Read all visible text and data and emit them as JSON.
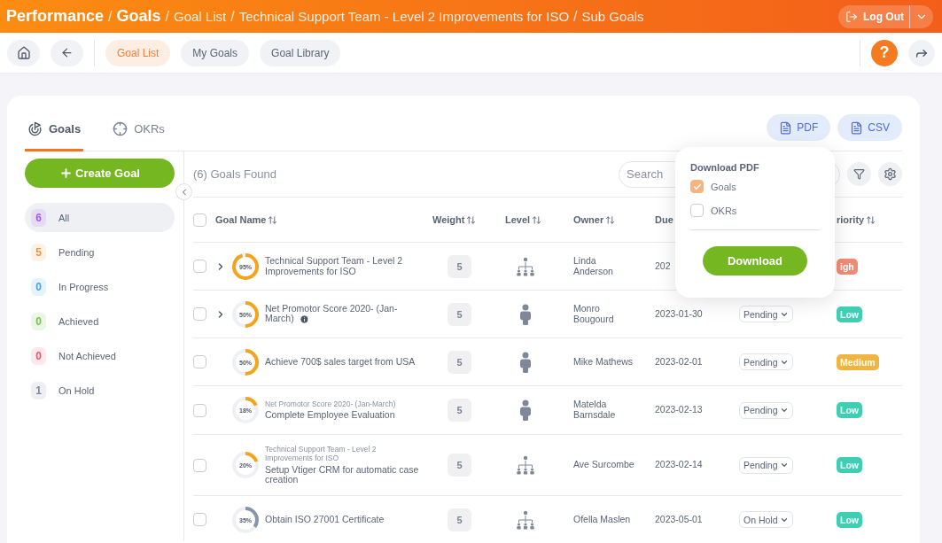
{
  "breadcrumb": {
    "separator": "/",
    "items": [
      {
        "label": "Performance",
        "kind": "main"
      },
      {
        "label": "Goals",
        "kind": "main"
      },
      {
        "label": "Goal List",
        "kind": "sub"
      },
      {
        "label": "Technical Support Team - Level 2 Improvements for ISO",
        "kind": "sub"
      },
      {
        "label": "Sub Goals",
        "kind": "sub"
      }
    ]
  },
  "logout": {
    "label": "Log Out"
  },
  "nav": {
    "tabs": [
      {
        "label": "Goal List",
        "selected": true
      },
      {
        "label": "My Goals",
        "selected": false
      },
      {
        "label": "Goal Library",
        "selected": false
      }
    ],
    "help": "?"
  },
  "view_tabs": [
    {
      "label": "Goals",
      "kind": "goals",
      "selected": true
    },
    {
      "label": "OKRs",
      "kind": "okrs",
      "selected": false
    }
  ],
  "export_buttons": [
    "PDF",
    "CSV"
  ],
  "create_button": "Create Goal",
  "filters": [
    {
      "count": "6",
      "label": "All",
      "selected": true,
      "color": "#a855f7"
    },
    {
      "count": "5",
      "label": "Pending",
      "selected": false,
      "color": "#f5933a"
    },
    {
      "count": "0",
      "label": "In Progress",
      "selected": false,
      "color": "#3ba3f0"
    },
    {
      "count": "0",
      "label": "Achieved",
      "selected": false,
      "color": "#6cc644"
    },
    {
      "count": "0",
      "label": "Not Achieved",
      "selected": false,
      "color": "#f0506e"
    },
    {
      "count": "1",
      "label": "On Hold",
      "selected": false,
      "color": "#7b879c"
    }
  ],
  "results": "(6) Goals Found",
  "search": {
    "placeholder": "Search"
  },
  "select_all": {
    "checked": false
  },
  "columns": [
    {
      "label": "Goal Name",
      "kind": "name",
      "sortable": true
    },
    {
      "label": "Weight",
      "kind": "weight",
      "sortable": true
    },
    {
      "label": "Level",
      "kind": "level",
      "sortable": true
    },
    {
      "label": "Owner",
      "kind": "owner",
      "sortable": true
    },
    {
      "label": "Due",
      "kind": "due"
    },
    {
      "label": "riority",
      "kind": "priority",
      "sortable": true
    }
  ],
  "rows": [
    {
      "checked": false,
      "expandable": true,
      "progress": "95%",
      "color": "#f5a31a",
      "name": "Technical Support Team - Level 2 Improvements for ISO",
      "info": false,
      "weight": "5",
      "kind": "team",
      "owner": "Linda Anderson",
      "due": "202",
      "priority": {
        "label": "igh",
        "color": "#f28b74"
      }
    },
    {
      "checked": false,
      "expandable": true,
      "progress": "50%",
      "color": "#f5a31a",
      "name": "Net Promotor Score 2020- (Jan-March)",
      "info": true,
      "weight": "5",
      "kind": "individual",
      "owner": "Monro Bougourd",
      "due": "2023-01-30",
      "status": "Pending",
      "priority": {
        "label": "Low",
        "color": "#3ecfb2"
      }
    },
    {
      "checked": false,
      "expandable": false,
      "progress": "50%",
      "color": "#f5a31a",
      "name": "Achieve 700$ sales target from USA",
      "info": false,
      "weight": "5",
      "kind": "individual",
      "owner": "Mike Mathews",
      "due": "2023-02-01",
      "status": "Pending",
      "priority": {
        "label": "Medium",
        "color": "#f0b440"
      }
    },
    {
      "checked": false,
      "expandable": false,
      "progress": "18%",
      "color": "#f5a31a",
      "parent": "Net Promotor Score 2020- (Jan-March)",
      "name": "Complete Employee Evaluation",
      "info": false,
      "weight": "5",
      "kind": "individual",
      "owner": "Matelda Barnsdale",
      "due": "2023-02-13",
      "status": "Pending",
      "priority": {
        "label": "Low",
        "color": "#3ecfb2"
      }
    },
    {
      "checked": false,
      "expandable": false,
      "progress": "20%",
      "color": "#f5a31a",
      "parent": "Technical Support Team - Level 2 Improvements for ISO",
      "name": "Setup Vtiger CRM for automatic case creation",
      "info": false,
      "weight": "5",
      "kind": "team",
      "owner": "Ave Surcombe",
      "due": "2023-02-14",
      "status": "Pending",
      "priority": {
        "label": "Low",
        "color": "#3ecfb2"
      }
    },
    {
      "checked": false,
      "expandable": false,
      "progress": "35%",
      "color": "#8796a8",
      "name": "Obtain ISO 27001 Certificate",
      "info": false,
      "weight": "5",
      "kind": "team",
      "owner": "Ofella Maslen",
      "due": "2023-05-01",
      "status": "On Hold",
      "priority": {
        "label": "Low",
        "color": "#3ecfb2"
      }
    }
  ],
  "popup": {
    "title": "Download PDF",
    "options": [
      {
        "label": "Goals",
        "checked": true
      },
      {
        "label": "OKRs",
        "checked": false
      }
    ],
    "button": "Download"
  }
}
